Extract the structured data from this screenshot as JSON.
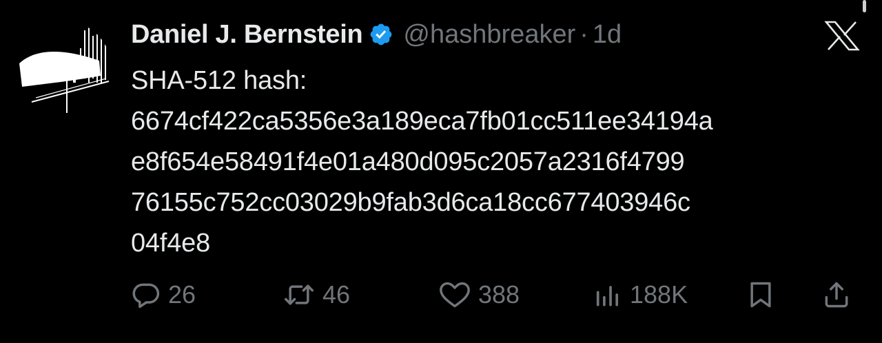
{
  "tweet": {
    "author": {
      "display_name": "Daniel J. Bernstein",
      "handle": "@hashbreaker",
      "separator": "·",
      "time": "1d",
      "verified_icon": "verified-badge-icon",
      "verified_color": "#1d9bf0"
    },
    "body_lines": [
      "SHA-512 hash:",
      "6674cf422ca5356e3a189eca7fb01cc511ee34194a",
      "e8f654e58491f4e01a480d095c2057a2316f4799",
      "76155c752cc03029b9fab3d6ca18cc677403946c",
      "04f4e8"
    ],
    "actions": {
      "replies": "26",
      "retweets": "46",
      "likes": "388",
      "views": "188K"
    }
  },
  "colors": {
    "background": "#000000",
    "primary_text": "#e7e9ea",
    "secondary_text": "#71767b",
    "accent": "#1d9bf0"
  },
  "icons": {
    "close": "x-logo-icon",
    "reply": "reply-icon",
    "retweet": "retweet-icon",
    "like": "heart-icon",
    "views": "views-chart-icon",
    "bookmark": "bookmark-icon",
    "share": "share-icon"
  }
}
